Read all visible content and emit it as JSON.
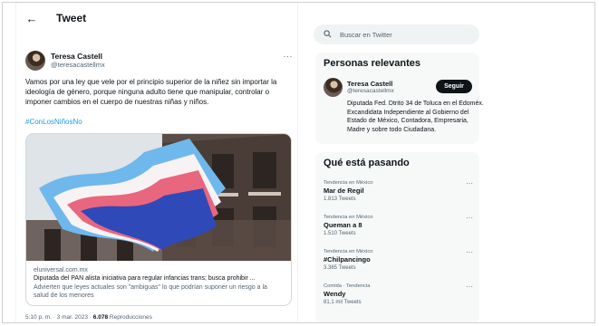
{
  "header": {
    "title": "Tweet"
  },
  "tweet": {
    "author_name": "Teresa Castell",
    "author_handle": "@teresacastellmx",
    "more": "···",
    "text": "Vamos por una ley que vele por el principio superior de la niñez sin importar la ideología de género, porque ninguna adulto tiene que manipular, controlar o imponer cambios en el cuerpo de nuestras niñas y niños.",
    "hashtag": "#ConLosNiñosNo",
    "meta_prefix": "5:10 p. m. · 3 mar. 2023 · ",
    "meta_views": "6.078",
    "meta_suffix": " Reproducciones"
  },
  "card": {
    "domain": "eluniversal.com.mx",
    "title": "Diputada del PAN alista iniciativa para regular infancias trans; busca prohibir ...",
    "description": "Advierten que leyes actuales son \"ambiguas\" lo que podrían suponer un riesgo a la salud de los menores"
  },
  "search": {
    "placeholder": "Buscar en Twitter"
  },
  "relevant": {
    "title": "Personas relevantes",
    "name": "Teresa Castell",
    "handle": "@teresacastellmx",
    "follow_label": "Seguir",
    "bio": "Diputada Fed. Dtrito 34 de Toluca en el Edoméx. Excandidata Independiente al Gobierno del Estado de México, Contadora, Empresaria, Madre y sobre todo Ciudadana."
  },
  "trends": {
    "title": "Qué está pasando",
    "items": [
      {
        "context": "Tendencia en México",
        "name": "Mar de Regil",
        "count": "1.813 Tweets"
      },
      {
        "context": "Tendencia en México",
        "name": "Queman a 8",
        "count": "1.510 Tweets"
      },
      {
        "context": "Tendencia en México",
        "name": "#Chilpancingo",
        "count": "3.365 Tweets"
      },
      {
        "context": "Comida · Tendencia",
        "name": "Wendy",
        "count": "81,1 mil Tweets"
      }
    ]
  },
  "colors": {
    "accent": "#1d9bf0",
    "text": "#0f1419",
    "muted": "#536471",
    "panel": "#f7f9f9"
  },
  "icons": {
    "back": "arrow-left-icon",
    "search": "search-icon",
    "more": "more-icon"
  }
}
